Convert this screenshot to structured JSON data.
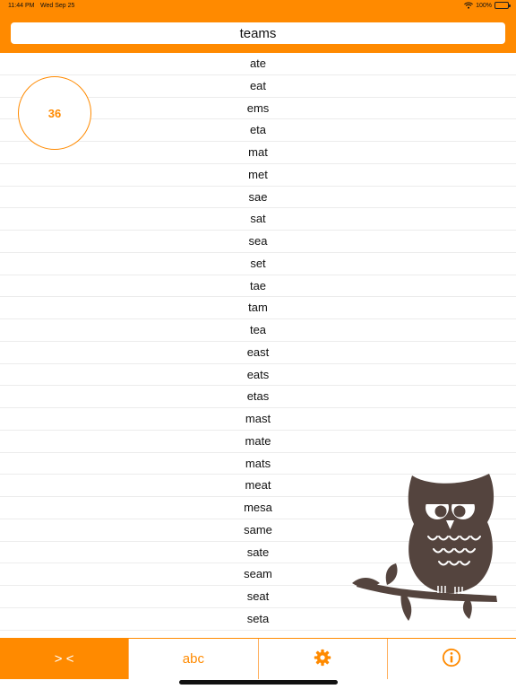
{
  "status_bar": {
    "time": "11:44 PM",
    "date": "Wed Sep 25",
    "battery": "100%"
  },
  "search": {
    "value": "teams"
  },
  "count": "36",
  "words": [
    "ate",
    "eat",
    "ems",
    "eta",
    "mat",
    "met",
    "sae",
    "sat",
    "sea",
    "set",
    "tae",
    "tam",
    "tea",
    "east",
    "eats",
    "etas",
    "mast",
    "mate",
    "mats",
    "meat",
    "mesa",
    "same",
    "sate",
    "seam",
    "seat",
    "seta"
  ],
  "tabs": [
    {
      "id": "anagram",
      "label": "> <",
      "active": true
    },
    {
      "id": "alphabetical",
      "label": "abc",
      "active": false
    },
    {
      "id": "settings",
      "icon": "gear-icon",
      "active": false
    },
    {
      "id": "info",
      "icon": "info-icon",
      "active": false
    }
  ],
  "colors": {
    "accent": "#ff8a00",
    "owl": "#54443e"
  }
}
